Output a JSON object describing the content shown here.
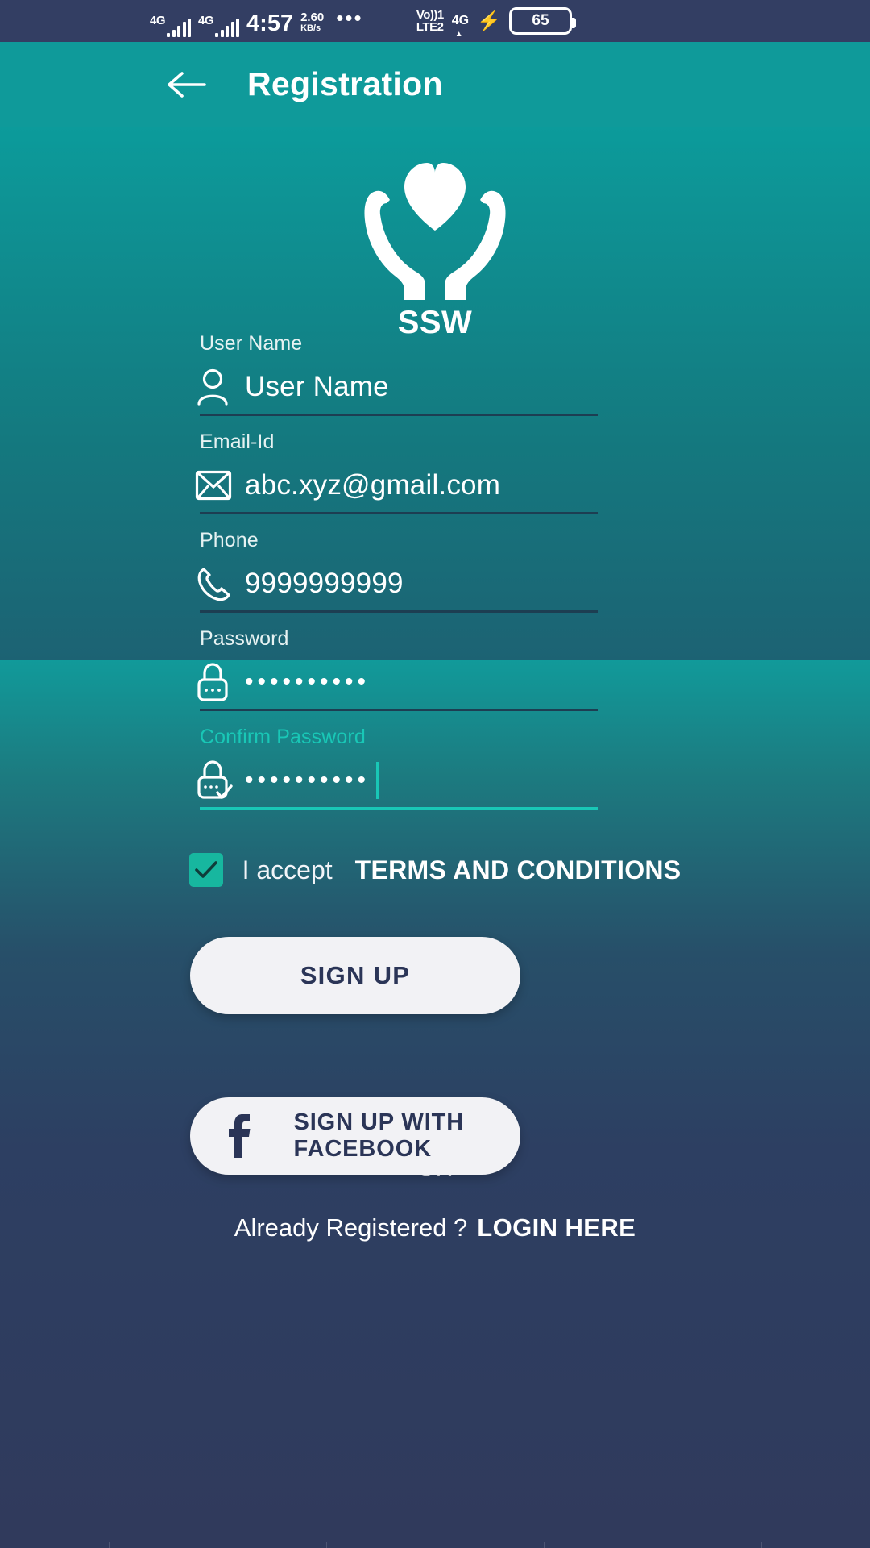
{
  "statusbar": {
    "network_1": "4G",
    "network_2": "4G",
    "time": "4:57",
    "speed_value": "2.60",
    "speed_unit": "KB/s",
    "more_dots": "•••",
    "volte_line1": "Vo))1",
    "volte_line2": "LTE2",
    "network_right": "4G",
    "charging_icon": "bolt-icon",
    "battery_level": "65"
  },
  "appbar": {
    "back_label": "back-arrow",
    "title": "Registration",
    "background_color": "#0f9a9a"
  },
  "logo": {
    "mark": "hands-holding-heart-icon",
    "text": "SSW"
  },
  "form": {
    "fields": [
      {
        "label": "User Name",
        "value": "User Name",
        "placeholder": "User Name",
        "icon": "person-icon",
        "focused": false
      },
      {
        "label": "Email-Id",
        "value": "abc.xyz@gmail.com",
        "placeholder": "Email-Id",
        "icon": "envelope-icon",
        "focused": false
      },
      {
        "label": "Phone",
        "value": "9999999999",
        "placeholder": "Phone",
        "icon": "phone-icon",
        "focused": false
      },
      {
        "label": "Password",
        "value": "••••••••••",
        "placeholder": "Password",
        "icon": "lock-icon",
        "focused": false
      },
      {
        "label": "Confirm Password",
        "value": "••••••••••",
        "placeholder": "Confirm Password",
        "icon": "lock-check-icon",
        "focused": true
      }
    ]
  },
  "terms": {
    "checked": true,
    "accept_text": "I accept",
    "link_text": "TERMS AND CONDITIONS",
    "checkbox_color": "#17b79f"
  },
  "actions": {
    "signup_label": "SIGN UP",
    "divider_label": "-----OR-----",
    "facebook_label": "SIGN UP WITH FACEBOOK",
    "facebook_icon": "facebook-icon"
  },
  "footer": {
    "question": "Already Registered ?",
    "link": "LOGIN HERE"
  },
  "colors": {
    "accent_teal": "#19c7b6",
    "appbar_teal": "#0f9a9a",
    "navy": "#2b3557",
    "statusbar": "#333e63"
  }
}
